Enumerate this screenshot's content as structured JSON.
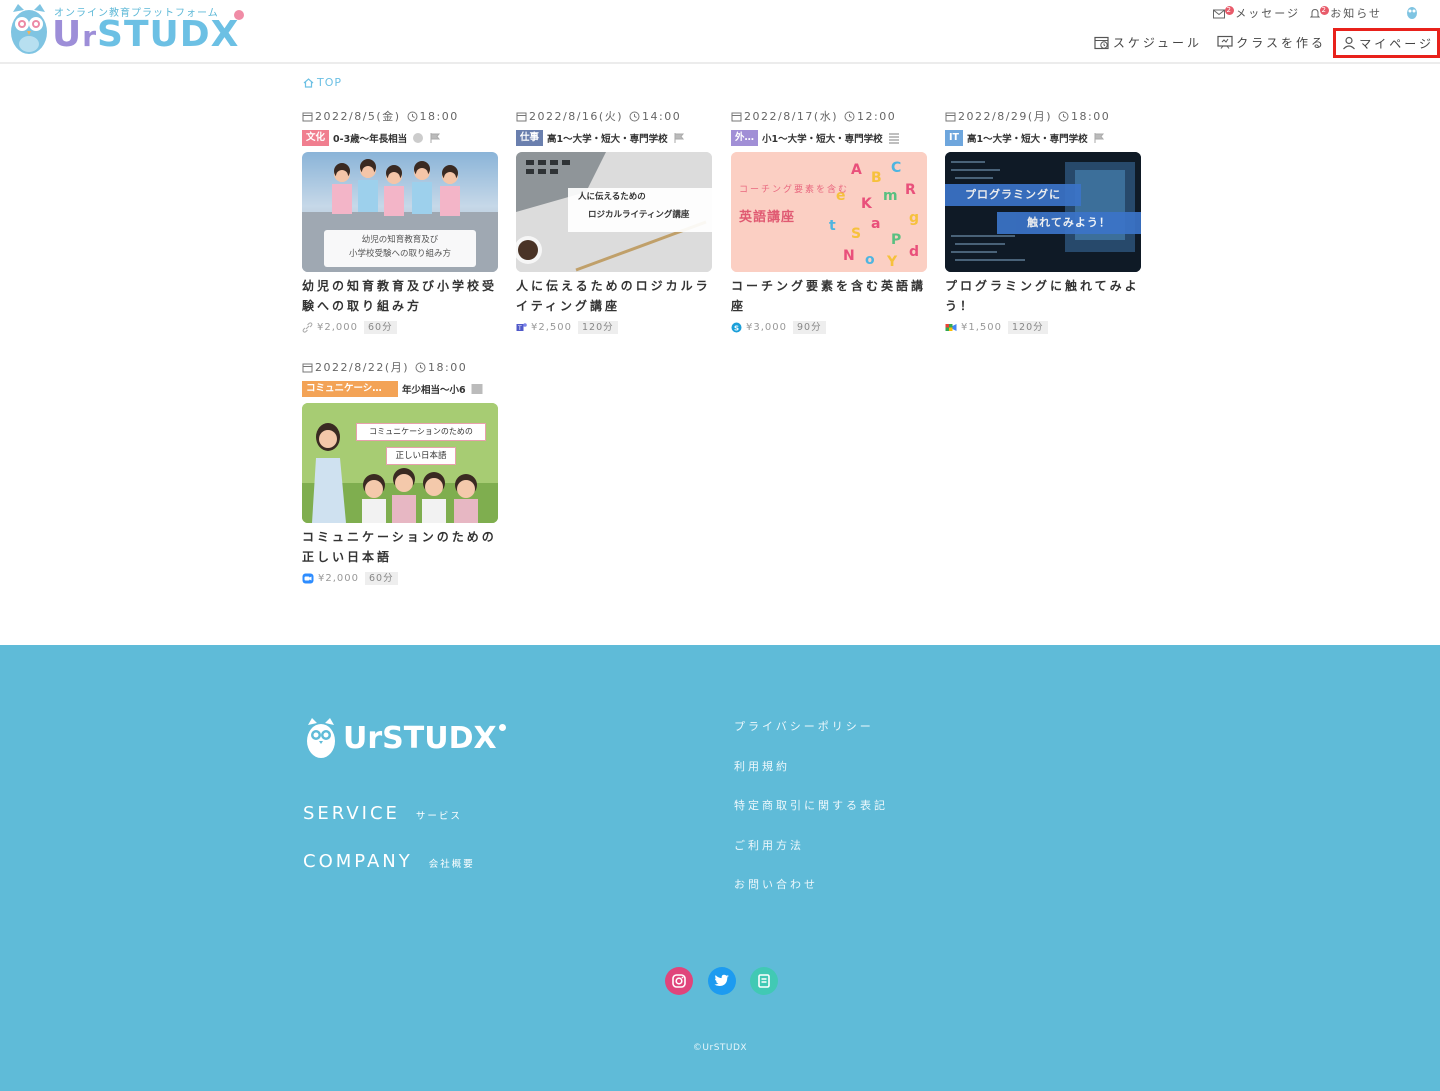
{
  "header": {
    "tagline": "オンライン教育プラットフォーム",
    "logo_text": "UrSTUDX",
    "util": {
      "messages": "メッセージ",
      "notices": "お知らせ",
      "messages_count": "2",
      "notices_count": "2"
    },
    "nav": {
      "schedule": "スケジュール",
      "create_class": "クラスを作る",
      "mypage": "マイページ"
    }
  },
  "breadcrumb": "TOP",
  "cards": [
    {
      "date": "2022/8/5(金)",
      "time": "18:00",
      "category": "文化",
      "category_color": "#f07e8f",
      "target": "0-3歳〜年長相当",
      "thumb_caption1": "幼児の知育教育及び",
      "thumb_caption2": "小学校受験への取り組み方",
      "title": "幼児の知育教育及び小学校受験への取り組み方",
      "price": "¥2,000",
      "duration": "60分",
      "platform_icon": "link-icon"
    },
    {
      "date": "2022/8/16(火)",
      "time": "14:00",
      "category": "仕事",
      "category_color": "#6a7fae",
      "target": "高1〜大学・短大・専門学校",
      "thumb_caption1": "人に伝えるための",
      "thumb_caption2": "ロジカルライティング講座",
      "title": "人に伝えるためのロジカルライティング講座",
      "price": "¥2,500",
      "duration": "120分",
      "platform_icon": "teams-icon"
    },
    {
      "date": "2022/8/17(水)",
      "time": "12:00",
      "category": "外…",
      "category_color": "#a18fd6",
      "target": "小1〜大学・短大・専門学校",
      "thumb_caption1": "コーチング要素を含む",
      "thumb_caption2": "英語講座",
      "title": "コーチング要素を含む英語講座",
      "price": "¥3,000",
      "duration": "90分",
      "platform_icon": "skype-icon"
    },
    {
      "date": "2022/8/29(月)",
      "time": "18:00",
      "category": "IT",
      "category_color": "#6ea6dd",
      "target": "高1〜大学・短大・専門学校",
      "thumb_caption1": "プログラミングに",
      "thumb_caption2": "触れてみよう！",
      "title": "プログラミングに触れてみよう！",
      "price": "¥1,500",
      "duration": "120分",
      "platform_icon": "meet-icon"
    },
    {
      "date": "2022/8/22(月)",
      "time": "18:00",
      "category": "コミュニケーシ…",
      "category_color": "#f3a356",
      "target": "年少相当〜小6",
      "thumb_caption1": "コミュニケーションのための",
      "thumb_caption2": "正しい日本語",
      "title": "コミュニケーションのための正しい日本語",
      "price": "¥2,000",
      "duration": "60分",
      "platform_icon": "zoom-icon"
    }
  ],
  "footer": {
    "logo_text": "UrSTUDX",
    "service": "SERVICE",
    "service_sub": "サービス",
    "company": "COMPANY",
    "company_sub": "会社概要",
    "links": [
      "プライバシーポリシー",
      "利用規約",
      "特定商取引に関する表記",
      "ご利用方法",
      "お問い合わせ"
    ],
    "copyright": "©UrSTUDX",
    "colors": {
      "background": "#5fbbd8",
      "instagram": "#e0457b",
      "twitter": "#1d9bf0",
      "note": "#41c9b4"
    }
  }
}
